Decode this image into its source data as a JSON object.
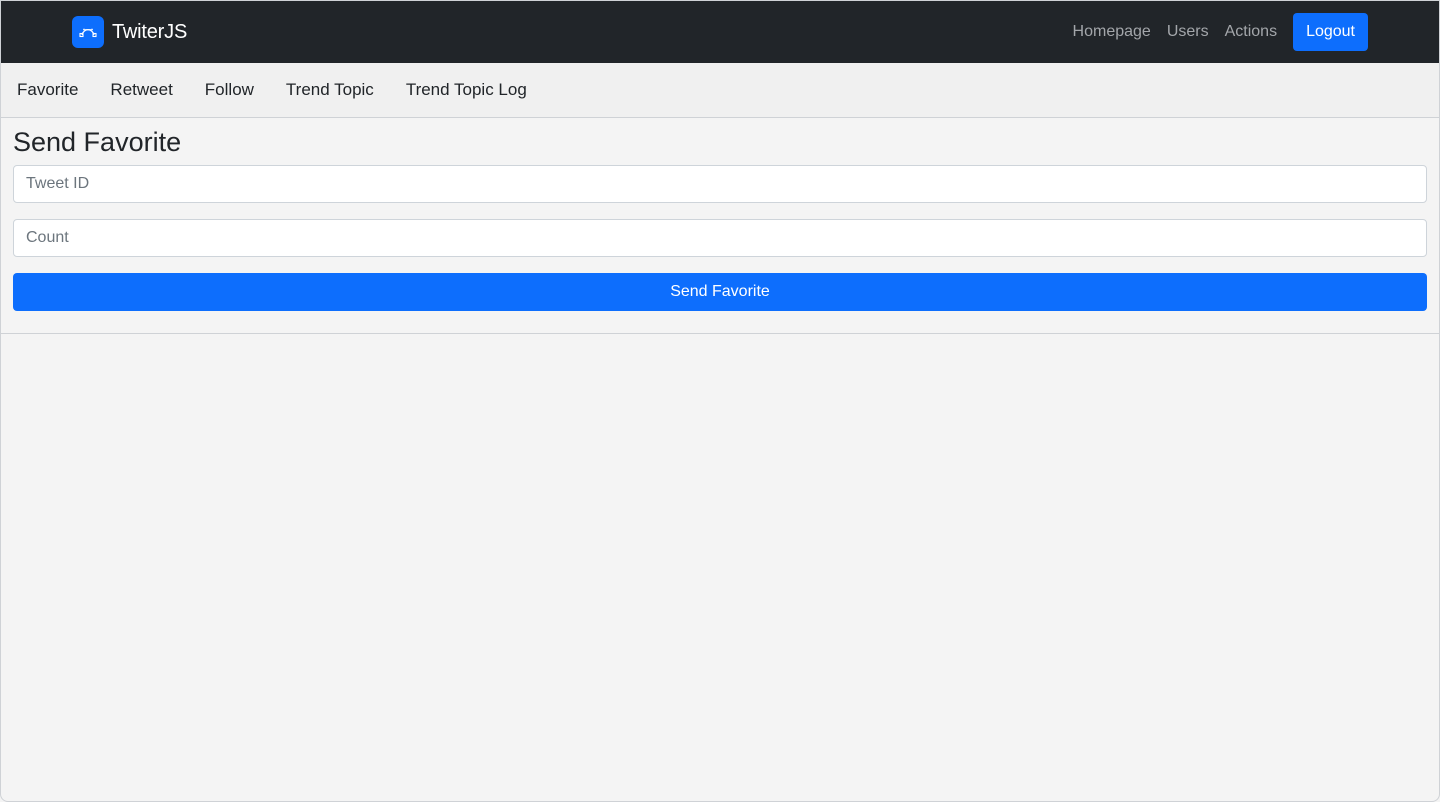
{
  "navbar": {
    "brand": "TwiterJS",
    "brand_icon": "bezier-curve-icon",
    "links": [
      {
        "label": "Homepage"
      },
      {
        "label": "Users"
      },
      {
        "label": "Actions"
      }
    ],
    "logout_label": "Logout"
  },
  "subnav": {
    "items": [
      {
        "label": "Favorite"
      },
      {
        "label": "Retweet"
      },
      {
        "label": "Follow"
      },
      {
        "label": "Trend Topic"
      },
      {
        "label": "Trend Topic Log"
      }
    ]
  },
  "form": {
    "title": "Send Favorite",
    "tweet_id": {
      "placeholder": "Tweet ID",
      "value": ""
    },
    "count": {
      "placeholder": "Count",
      "value": ""
    },
    "submit_label": "Send Favorite"
  },
  "colors": {
    "navbar_bg": "#212529",
    "primary": "#0d6efd",
    "page_bg": "#f4f4f4"
  }
}
